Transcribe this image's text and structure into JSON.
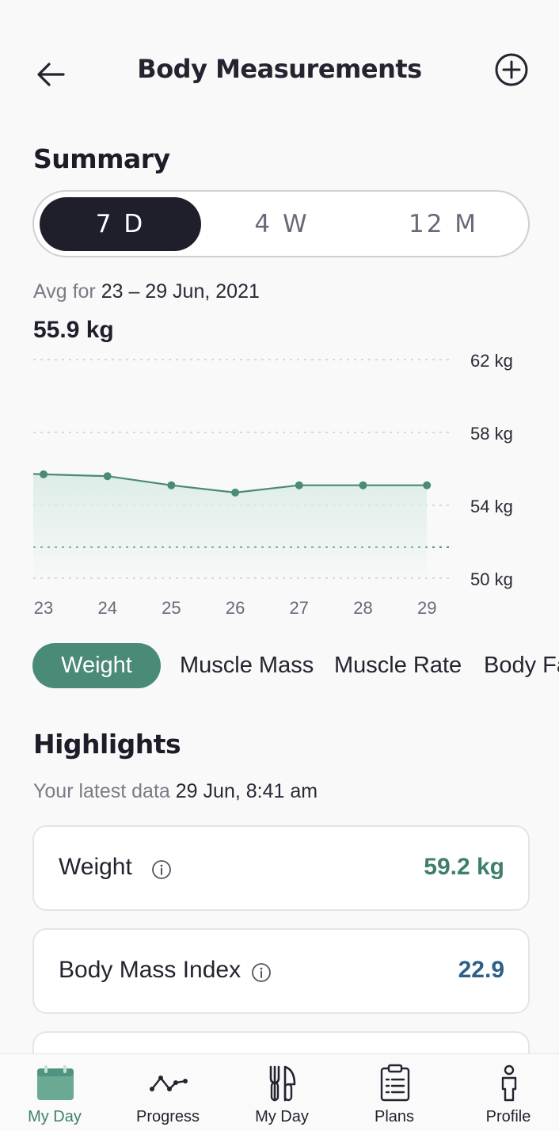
{
  "header": {
    "title": "Body Measurements"
  },
  "summary": {
    "title": "Summary",
    "ranges": [
      "7 D",
      "4 W",
      "12 M"
    ],
    "selected_range": "7 D",
    "avg_label": "Avg for",
    "avg_dates": "23 – 29 Jun, 2021",
    "avg_value": "55.9 kg"
  },
  "chart_data": {
    "type": "area",
    "x": [
      "23",
      "24",
      "25",
      "26",
      "27",
      "28",
      "29"
    ],
    "series": [
      {
        "values": [
          55.7,
          55.6,
          55.1,
          54.7,
          55.1,
          55.1,
          55.1
        ]
      }
    ],
    "y_ticks": [
      "62 kg",
      "58 kg",
      "54 kg",
      "50 kg"
    ],
    "ylim": [
      50,
      62
    ],
    "reference_line": 51.7,
    "grid": true,
    "colors": {
      "line": "#4a8a78",
      "fill": "#dcece6"
    }
  },
  "metrics": {
    "items": [
      "Weight",
      "Muscle Mass",
      "Muscle Rate",
      "Body Fat"
    ],
    "selected": "Weight"
  },
  "highlights": {
    "title": "Highlights",
    "latest_label": "Your latest data",
    "latest_datetime": "29 Jun, 8:41 am",
    "cards": [
      {
        "label": "Weight",
        "value": "59.2 kg",
        "color": "#3f7f6d"
      },
      {
        "label": "Body Mass Index",
        "value": "22.9",
        "color": "#2d5f87"
      }
    ]
  },
  "nav": {
    "items": [
      {
        "label": "My Day",
        "icon": "calendar-icon"
      },
      {
        "label": "Progress",
        "icon": "progress-icon"
      },
      {
        "label": "My Day",
        "icon": "cutlery-icon"
      },
      {
        "label": "Plans",
        "icon": "clipboard-icon"
      },
      {
        "label": "Profile",
        "icon": "person-icon"
      }
    ],
    "active_index": 0
  }
}
